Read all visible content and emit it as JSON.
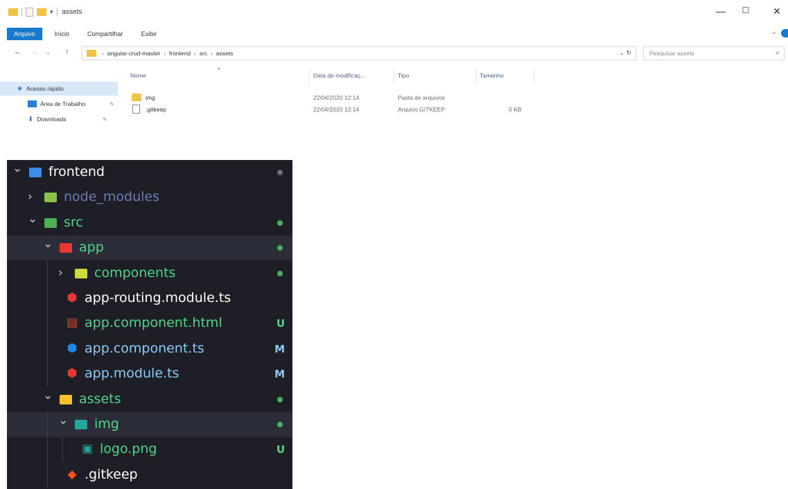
{
  "explorer": {
    "title": "assets",
    "window": {
      "minimize": "—",
      "maximize": "☐",
      "close": "✕"
    },
    "ribbon_tabs": [
      {
        "label": "Arquivo",
        "active": true
      },
      {
        "label": "Início",
        "active": false
      },
      {
        "label": "Compartilhar",
        "active": false
      },
      {
        "label": "Exibir",
        "active": false
      }
    ],
    "breadcrumb": [
      "angular-crud-master",
      "frontend",
      "src",
      "assets"
    ],
    "search_placeholder": "Pesquisar assets",
    "nav_pane": [
      {
        "label": "Acesso rápido",
        "icon": "star-icon",
        "selected": true
      },
      {
        "label": "Área de Trabalho",
        "icon": "desktop-icon",
        "pinned": true
      },
      {
        "label": "Downloads",
        "icon": "download-icon",
        "pinned": true
      }
    ],
    "columns": [
      "Nome",
      "Data de modificaç...",
      "Tipo",
      "Tamanho"
    ],
    "files": [
      {
        "name": "img",
        "modified": "22/04/2020 12:14",
        "type": "Pasta de arquivos",
        "size": "",
        "kind": "folder"
      },
      {
        "name": ".gitkeep",
        "modified": "22/04/2020 12:14",
        "type": "Arquivo GITKEEP",
        "size": "0 KB",
        "kind": "file"
      }
    ]
  },
  "vscode_tree": [
    {
      "label": "frontend",
      "expanded": true,
      "depth": 0,
      "label_color": "#ffffff",
      "icon_color": "#3b8eea",
      "badge": "dot",
      "badge_color": "#6c7086"
    },
    {
      "label": "node_modules",
      "expanded": false,
      "depth": 1,
      "label_color": "#6c7bb5",
      "icon_color": "#8bc34a",
      "badge": "",
      "badge_color": ""
    },
    {
      "label": "src",
      "expanded": true,
      "depth": 1,
      "label_color": "#50d48c",
      "icon_color": "#4caf50",
      "badge": "dot",
      "badge_color": "#48b060",
      "highlight": false
    },
    {
      "label": "app",
      "expanded": true,
      "depth": 2,
      "label_color": "#50d48c",
      "icon_color": "#e53935",
      "badge": "dot",
      "badge_color": "#48b060",
      "highlight": true
    },
    {
      "label": "components",
      "expanded": false,
      "depth": 3,
      "label_color": "#50d48c",
      "icon_color": "#cddc39",
      "badge": "dot",
      "badge_color": "#48b060"
    },
    {
      "label": "app-routing.module.ts",
      "depth": 3,
      "file": true,
      "label_color": "#ffffff",
      "icon_color": "#e53935",
      "glyph": "angular-icon",
      "badge": ""
    },
    {
      "label": "app.component.html",
      "depth": 3,
      "file": true,
      "label_color": "#50d48c",
      "icon_color": "#e44d26",
      "glyph": "html-icon",
      "badge": "U",
      "badge_color": "#50d48c"
    },
    {
      "label": "app.component.ts",
      "depth": 3,
      "file": true,
      "label_color": "#8dcbf5",
      "icon_color": "#1e88e5",
      "glyph": "angular-icon",
      "badge": "M",
      "badge_color": "#8dcbf5"
    },
    {
      "label": "app.module.ts",
      "depth": 3,
      "file": true,
      "label_color": "#8dcbf5",
      "icon_color": "#e53935",
      "glyph": "angular-icon",
      "badge": "M",
      "badge_color": "#8dcbf5"
    },
    {
      "label": "assets",
      "expanded": true,
      "depth": 2,
      "label_color": "#50d48c",
      "icon_color": "#fbc02d",
      "badge": "dot",
      "badge_color": "#48b060"
    },
    {
      "label": "img",
      "expanded": true,
      "depth": 3,
      "label_color": "#50d48c",
      "icon_color": "#26a69a",
      "badge": "dot",
      "badge_color": "#48b060",
      "highlight": true
    },
    {
      "label": "logo.png",
      "depth": 4,
      "file": true,
      "label_color": "#50d48c",
      "icon_color": "#26a69a",
      "glyph": "image-icon",
      "badge": "U",
      "badge_color": "#50d48c"
    },
    {
      "label": ".gitkeep",
      "depth": 3,
      "file": true,
      "label_color": "#ffffff",
      "icon_color": "#f4511e",
      "glyph": "git-icon",
      "badge": ""
    }
  ]
}
